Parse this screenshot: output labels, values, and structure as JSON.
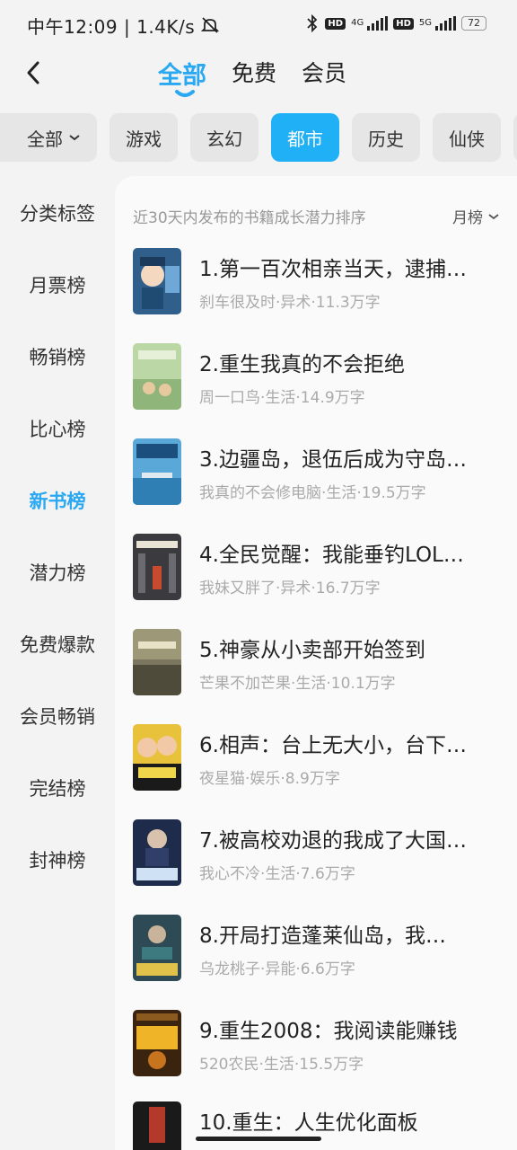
{
  "status_bar": {
    "time": "中午12:09 | 1.4K/s",
    "hd1": "HD",
    "net1": "4G",
    "hd2": "HD",
    "net2": "5G",
    "battery": "72"
  },
  "header": {
    "tabs": [
      "全部",
      "免费",
      "会员"
    ]
  },
  "chips": {
    "first": "全部",
    "items": [
      "游戏",
      "玄幻",
      "都市",
      "历史",
      "仙侠"
    ]
  },
  "sidebar": {
    "items": [
      "分类标签",
      "月票榜",
      "畅销榜",
      "比心榜",
      "新书榜",
      "潜力榜",
      "免费爆款",
      "会员畅销",
      "完结榜",
      "封神榜"
    ]
  },
  "list": {
    "description": "近30天内发布的书籍成长潜力排序",
    "sort_label": "月榜",
    "books": [
      {
        "title": "1.第一百次相亲当天，逮捕…",
        "meta": "刹车很及时·异术·11.3万字"
      },
      {
        "title": "2.重生我真的不会拒绝",
        "meta": "周一口鸟·生活·14.9万字"
      },
      {
        "title": "3.边疆岛，退伍后成为守岛…",
        "meta": "我真的不会修电脑·生活·19.5万字"
      },
      {
        "title": "4.全民觉醒：我能垂钓LOL…",
        "meta": "我妹又胖了·异术·16.7万字"
      },
      {
        "title": "5.神豪从小卖部开始签到",
        "meta": "芒果不加芒果·生活·10.1万字"
      },
      {
        "title": "6.相声：台上无大小，台下…",
        "meta": "夜星猫·娱乐·8.9万字"
      },
      {
        "title": "7.被高校劝退的我成了大国…",
        "meta": "我心不冷·生活·7.6万字"
      },
      {
        "title": "8.开局打造蓬莱仙岛，我…",
        "meta": "乌龙桃子·异能·6.6万字"
      },
      {
        "title": "9.重生2008：我阅读能赚钱",
        "meta": "520农民·生活·15.5万字"
      },
      {
        "title": "10.重生：人生优化面板",
        "meta": ""
      }
    ]
  },
  "colors": {
    "accent": "#2aa8f2",
    "chip_active": "#1fb0f5"
  }
}
